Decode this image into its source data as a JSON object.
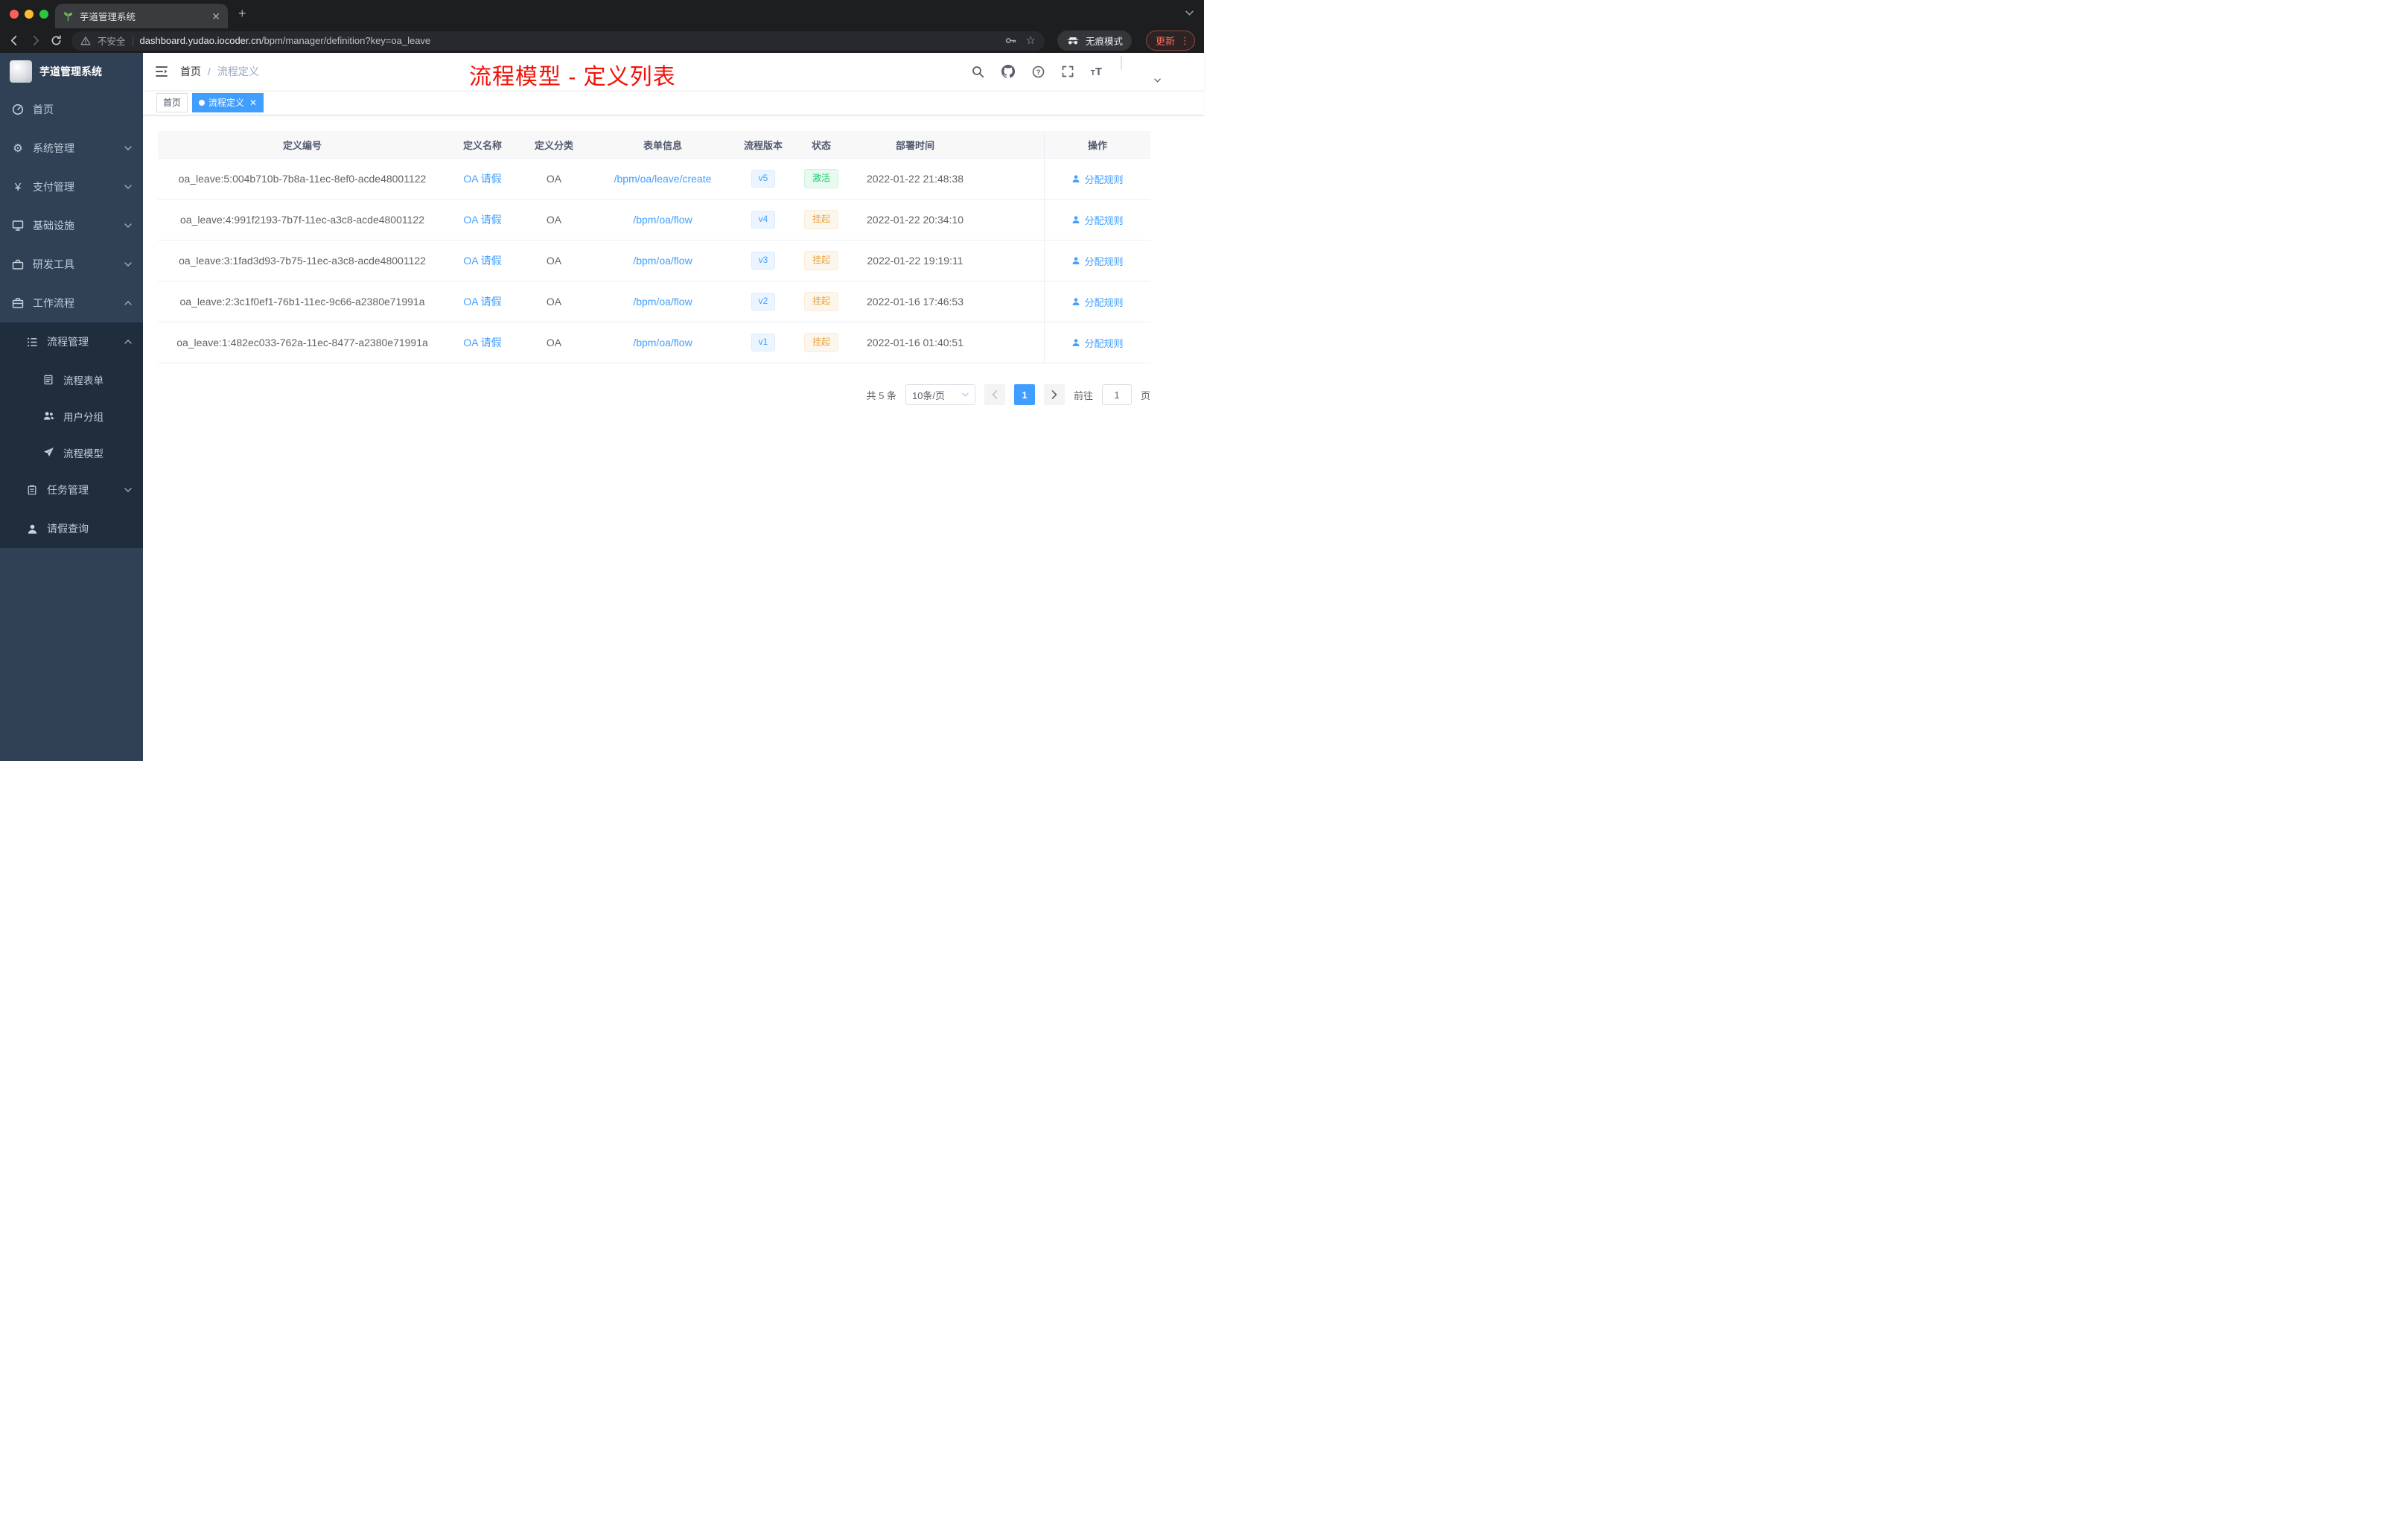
{
  "browser": {
    "tab_title": "芋道管理系统",
    "security_label": "不安全",
    "url_domain": "dashboard.yudao.iocoder.cn",
    "url_path": "/bpm/manager/definition?key=oa_leave",
    "incognito_label": "无痕模式",
    "update_label": "更新"
  },
  "sidebar": {
    "logo_title": "芋道管理系统",
    "home": "首页",
    "system": "系统管理",
    "payment": "支付管理",
    "infra": "基础设施",
    "devtools": "研发工具",
    "workflow": "工作流程",
    "process_mgmt": "流程管理",
    "process_form": "流程表单",
    "user_group": "用户分组",
    "process_model": "流程模型",
    "task_mgmt": "任务管理",
    "leave_query": "请假查询"
  },
  "header": {
    "breadcrumb_home": "首页",
    "breadcrumb_separator": "/",
    "breadcrumb_current": "流程定义",
    "annotation": "流程模型 - 定义列表"
  },
  "tags": {
    "home": "首页",
    "current": "流程定义"
  },
  "table": {
    "columns": [
      "定义编号",
      "定义名称",
      "定义分类",
      "表单信息",
      "流程版本",
      "状态",
      "部署时间",
      "操作"
    ],
    "rows": [
      {
        "id": "oa_leave:5:004b710b-7b8a-11ec-8ef0-acde48001122",
        "name": "OA 请假",
        "category": "OA",
        "form": "/bpm/oa/leave/create",
        "version": "v5",
        "status": "激活",
        "status_type": "success",
        "time": "2022-01-22 21:48:38",
        "action": "分配规则"
      },
      {
        "id": "oa_leave:4:991f2193-7b7f-11ec-a3c8-acde48001122",
        "name": "OA 请假",
        "category": "OA",
        "form": "/bpm/oa/flow",
        "version": "v4",
        "status": "挂起",
        "status_type": "warning",
        "time": "2022-01-22 20:34:10",
        "action": "分配规则"
      },
      {
        "id": "oa_leave:3:1fad3d93-7b75-11ec-a3c8-acde48001122",
        "name": "OA 请假",
        "category": "OA",
        "form": "/bpm/oa/flow",
        "version": "v3",
        "status": "挂起",
        "status_type": "warning",
        "time": "2022-01-22 19:19:11",
        "action": "分配规则"
      },
      {
        "id": "oa_leave:2:3c1f0ef1-76b1-11ec-9c66-a2380e71991a",
        "name": "OA 请假",
        "category": "OA",
        "form": "/bpm/oa/flow",
        "version": "v2",
        "status": "挂起",
        "status_type": "warning",
        "time": "2022-01-16 17:46:53",
        "action": "分配规则"
      },
      {
        "id": "oa_leave:1:482ec033-762a-11ec-8477-a2380e71991a",
        "name": "OA 请假",
        "category": "OA",
        "form": "/bpm/oa/flow",
        "version": "v1",
        "status": "挂起",
        "status_type": "warning",
        "time": "2022-01-16 01:40:51",
        "action": "分配规则"
      }
    ]
  },
  "pagination": {
    "total": "共 5 条",
    "page_size": "10条/页",
    "current_page": "1",
    "goto_label": "前往",
    "goto_value": "1",
    "unit_label": "页"
  },
  "colors": {
    "accent": "#409eff",
    "sidebar_bg": "#304156",
    "submenu_bg": "#1f2d3d",
    "success": "#13ce66",
    "warning": "#e6a23c",
    "annotation_red": "#f21207"
  }
}
